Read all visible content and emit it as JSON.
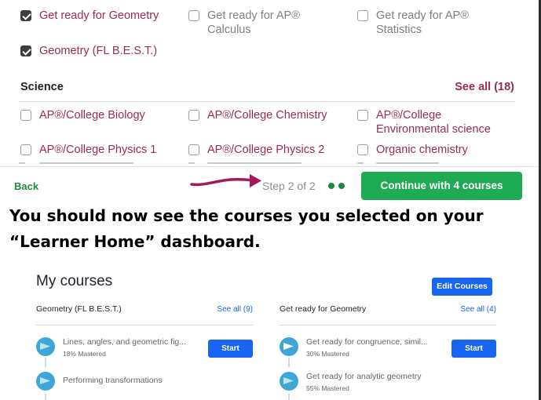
{
  "top_checkboxes": [
    {
      "label": "Get ready for Geometry",
      "checked": true
    },
    {
      "label": "Get ready for AP®\nCalculus",
      "checked": false
    },
    {
      "label": "Get ready for AP®\nStatistics",
      "checked": false
    },
    {
      "label": "Geometry (FL B.E.S.T.)",
      "checked": true
    }
  ],
  "science": {
    "heading": "Science",
    "see_all": "See all (18)",
    "items": [
      {
        "label": "AP®/College Biology",
        "checked": false
      },
      {
        "label": "AP®/College Chemistry",
        "checked": false
      },
      {
        "label": "AP®/College\nEnvironmental science",
        "checked": false
      },
      {
        "label": "AP®/College Physics 1",
        "checked": false
      },
      {
        "label": "AP®/College Physics 2",
        "checked": false
      },
      {
        "label": "Organic chemistry",
        "checked": false
      }
    ]
  },
  "footer": {
    "back_label": "Back",
    "step_label": "Step 2 of 2",
    "continue_label": "Continue with 4 courses"
  },
  "caption": "You should now see the courses you selected on your “Learner Home” dashboard.",
  "my_courses": {
    "title": "My courses",
    "edit_label": "Edit Courses",
    "cards": [
      {
        "title": "Geometry (FL B.E.S.T.)",
        "see_all": "See all (9)",
        "units": [
          {
            "name": "Lines, angles, and geometric fig...",
            "mastery": "18% Mastered",
            "action": "Start"
          },
          {
            "name": "Performing transformations",
            "mastery": "",
            "action": ""
          }
        ]
      },
      {
        "title": "Get ready for Geometry",
        "see_all": "See all (4)",
        "units": [
          {
            "name": "Get ready for congruence, simil...",
            "mastery": "30% Mastered",
            "action": "Start"
          },
          {
            "name": "Get ready for analytic geometry",
            "mastery": "55% Mastered",
            "action": ""
          }
        ]
      }
    ]
  },
  "colors": {
    "course_link": "#9c2a56",
    "primary_green": "#1fab54",
    "primary_blue": "#1865f2",
    "arrow": "#a3195b"
  }
}
